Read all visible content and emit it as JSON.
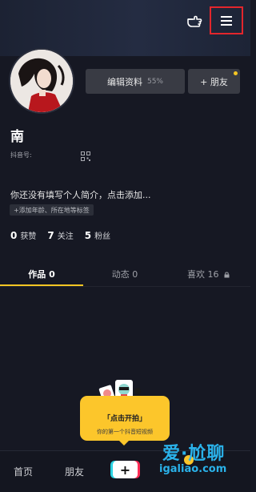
{
  "header": {
    "hand_icon": "pointing-hand-icon",
    "menu_icon": "hamburger-menu-icon",
    "highlight_color": "#e3262c"
  },
  "profile": {
    "edit_label": "编辑资料",
    "edit_progress": "55%",
    "add_friend_label": "+ 朋友",
    "nickname": "南",
    "id_label": "抖音号:",
    "bio_placeholder": "你还没有填写个人简介，点击添加...",
    "tag_hint": "+添加年龄、所在地等标签"
  },
  "stats": [
    {
      "value": "0",
      "label": "获赞"
    },
    {
      "value": "7",
      "label": "关注"
    },
    {
      "value": "5",
      "label": "粉丝"
    }
  ],
  "tabs": [
    {
      "label": "作品 0"
    },
    {
      "label": "动态 0"
    },
    {
      "label": "喜欢 16"
    }
  ],
  "bubble": {
    "title": "「点击开拍」",
    "subtitle": "你的第一个抖音短视频"
  },
  "bottom_nav": {
    "home": "首页",
    "friends": "朋友",
    "plus": "+"
  },
  "watermark": {
    "line1": "爱·尬聊",
    "line2": "igaliao.com"
  },
  "colors": {
    "accent": "#f5c623",
    "background": "#161823",
    "bubble": "#fcc62b"
  }
}
